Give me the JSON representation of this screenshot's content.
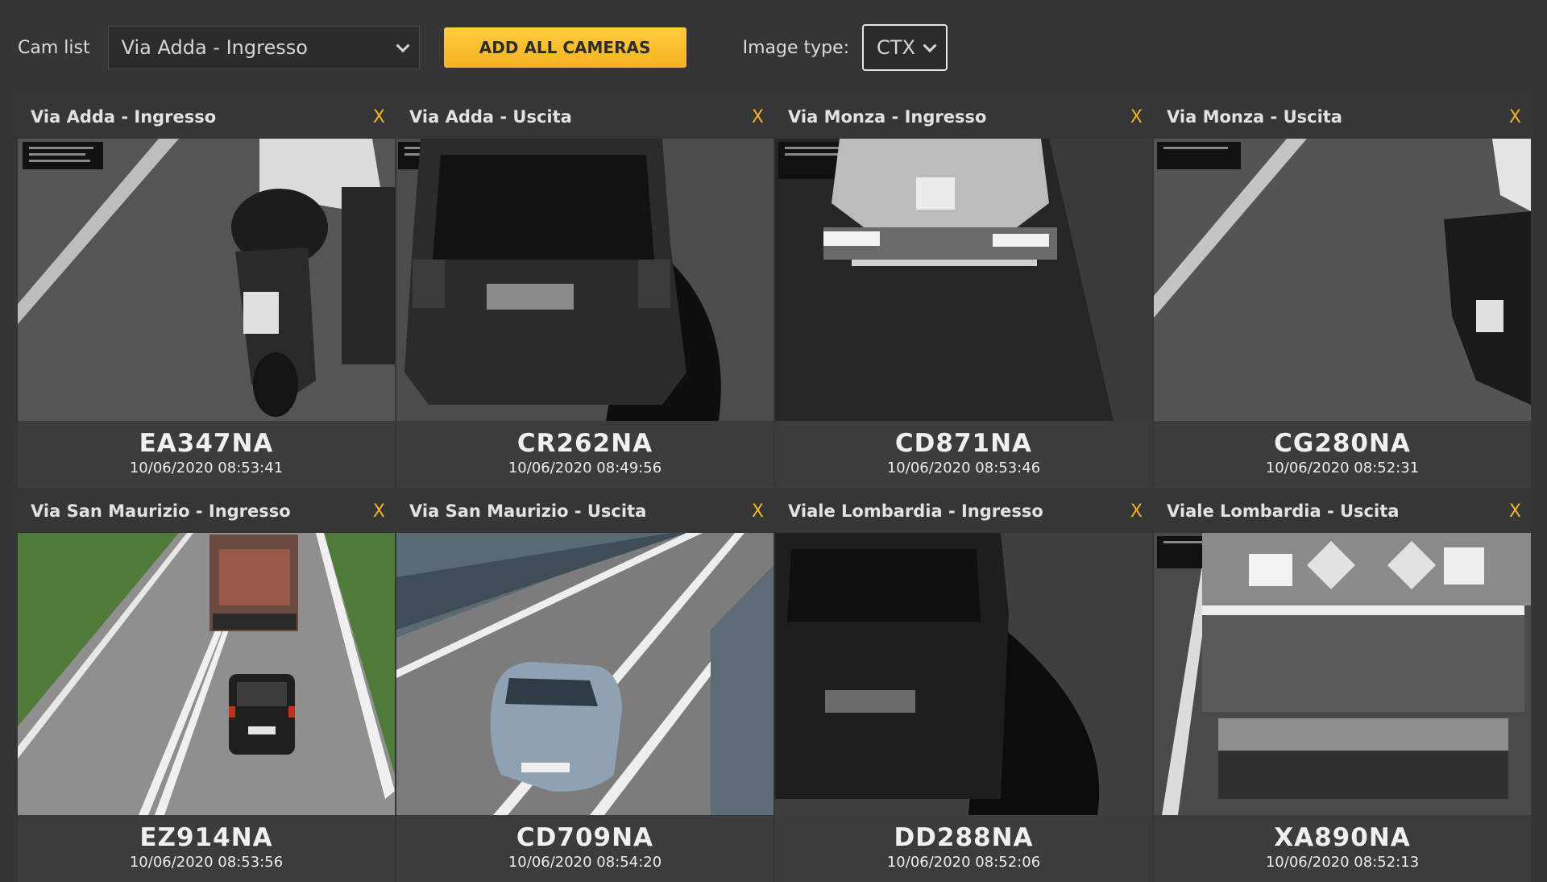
{
  "toolbar": {
    "cam_list_label": "Cam list",
    "cam_list_value": "Via Adda - Ingresso",
    "add_all_label": "ADD ALL CAMERAS",
    "image_type_label": "Image type:",
    "image_type_value": "CTX"
  },
  "colors": {
    "accent": "#f4b322",
    "background": "#353535",
    "panel": "#3c3c3c"
  },
  "cameras": [
    {
      "title": "Via Adda - Ingresso",
      "plate": "EA347NA",
      "timestamp": "10/06/2020 08:53:41",
      "close": "X",
      "scene": "motorbike-rear-grayscale"
    },
    {
      "title": "Via Adda - Uscita",
      "plate": "CR262NA",
      "timestamp": "10/06/2020 08:49:56",
      "close": "X",
      "scene": "car-rear-grayscale"
    },
    {
      "title": "Via Monza - Ingresso",
      "plate": "CD871NA",
      "timestamp": "10/06/2020 08:53:46",
      "close": "X",
      "scene": "tanker-truck-rear-grayscale"
    },
    {
      "title": "Via Monza - Uscita",
      "plate": "CG280NA",
      "timestamp": "10/06/2020 08:52:31",
      "close": "X",
      "scene": "motorbike-side-grayscale"
    },
    {
      "title": "Via San Maurizio - Ingresso",
      "plate": "EZ914NA",
      "timestamp": "10/06/2020 08:53:56",
      "close": "X",
      "scene": "road-truck-car-color"
    },
    {
      "title": "Via San Maurizio - Uscita",
      "plate": "CD709NA",
      "timestamp": "10/06/2020 08:54:20",
      "close": "X",
      "scene": "bridge-car-color"
    },
    {
      "title": "Viale Lombardia - Ingresso",
      "plate": "DD288NA",
      "timestamp": "10/06/2020 08:52:06",
      "close": "X",
      "scene": "car-rear-dark-grayscale"
    },
    {
      "title": "Viale Lombardia - Uscita",
      "plate": "XA890NA",
      "timestamp": "10/06/2020 08:52:13",
      "close": "X",
      "scene": "truck-rear-hazard-grayscale"
    }
  ]
}
